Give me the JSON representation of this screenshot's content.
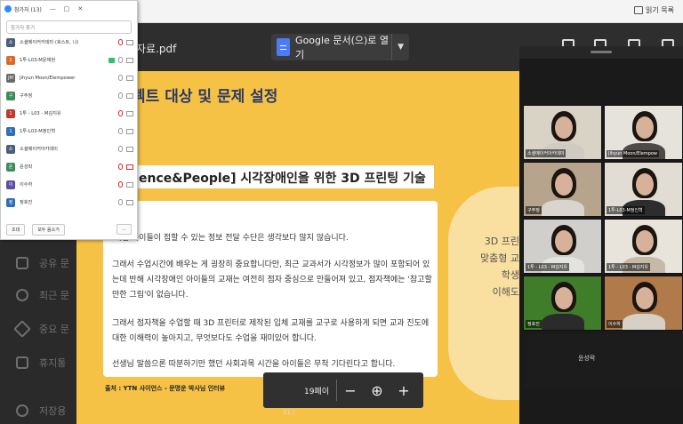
{
  "browser": {
    "reading_list": "읽기 목록"
  },
  "drive_sidebar": {
    "items": [
      {
        "label": "공유 문",
        "icon": "people-icon"
      },
      {
        "label": "최근 문",
        "icon": "clock-icon"
      },
      {
        "label": "중요 문",
        "icon": "star-icon"
      },
      {
        "label": "휴지통",
        "icon": "trash-icon"
      },
      {
        "label": "저장용",
        "icon": "cloud-icon"
      }
    ]
  },
  "pdf_viewer": {
    "filename": "자료.pdf",
    "open_with_label": "Google 문서(으)로 열기",
    "page_label": "19페이",
    "bottom_page_hint": "11   /",
    "toolbar_icons": [
      "folder-icon",
      "add-icon",
      "print-icon",
      "download-icon",
      "more-icon"
    ]
  },
  "slide": {
    "heading": "젝트 대상 및 문제 설정",
    "subtitle": "ence&People] 시각장애인을 위한 3D 프린팅 기술",
    "paragraphs": [
      "'애인 아이들이 접할 수 있는 정보 전달 수단은 생각보다 많지 않습니다.",
      "그래서 수업시간에 배우는 게 굉장히 중요합니다만, 최근 교과서가 시각정보가 많이 포함되어 있는데 반해 시각장애인 아이들의 교재는 여전히 점자 중심으로 만들어져 있고, 점자책에는 '참고할 만한 그림'이 없습니다.",
      "그래서 점자책을 수업할 때 3D 프린터로 제작된 입체 교재를 교구로 사용하게 되면 교과 진도에 대한 이해력이 높아지고, 무엇보다도 수업을 재미있어 합니다.",
      "선생님 말씀으론 따분하기만 했던 사회과목 시간을 아이들은 무척 기다린다고 합니다."
    ],
    "source": "출처 : YTN 사이언스 - 문명운 박사님 인터뷰",
    "side_text": [
      "3D 프린",
      "맞춤형 교",
      "학생",
      "이해도"
    ],
    "colors": {
      "background": "#f6c246",
      "heading": "#2b3a67",
      "underline": "#d22222"
    }
  },
  "participants_panel": {
    "title": "참가자 (13)",
    "search_placeholder": "참가자 찾기",
    "participants": [
      {
        "name": "소셜메이커카데미 (호스트, 나)",
        "avatar_text": "소",
        "avatar_color": "#4c5d7a",
        "mic_muted": true,
        "cam_off": false,
        "sharing": false
      },
      {
        "name": "1투-L03-M문채현",
        "avatar_text": "1",
        "avatar_color": "#d96b2b",
        "mic_muted": false,
        "cam_off": false,
        "sharing": true
      },
      {
        "name": "Jihyun Moon/Elempower",
        "avatar_text": "JM",
        "avatar_color": "#6a6a6a",
        "mic_muted": false,
        "cam_off": false,
        "sharing": false
      },
      {
        "name": "구주정",
        "avatar_text": "구",
        "avatar_color": "#3b8c5a",
        "mic_muted": false,
        "cam_off": false,
        "sharing": false
      },
      {
        "name": "1투 - L03 - M김지유",
        "avatar_text": "1",
        "avatar_color": "#c0392b",
        "mic_muted": true,
        "cam_off": false,
        "sharing": false
      },
      {
        "name": "1투-L03-M정인혁",
        "avatar_text": "1",
        "avatar_color": "#2e6fb7",
        "mic_muted": false,
        "cam_off": false,
        "sharing": false
      },
      {
        "name": "소셜메이커아카데미",
        "avatar_text": "소",
        "avatar_color": "#4c5d7a",
        "mic_muted": false,
        "cam_off": false,
        "sharing": false
      },
      {
        "name": "윤성락",
        "avatar_text": "윤",
        "avatar_color": "#3b8c5a",
        "mic_muted": true,
        "cam_off": true,
        "sharing": false
      },
      {
        "name": "이수하",
        "avatar_text": "이",
        "avatar_color": "#5a4fa3",
        "mic_muted": true,
        "cam_off": false,
        "sharing": false
      },
      {
        "name": "정호진",
        "avatar_text": "정",
        "avatar_color": "#2e6fb7",
        "mic_muted": false,
        "cam_off": false,
        "sharing": false
      }
    ],
    "footer": {
      "invite": "초대",
      "mute_all": "모두 음소거",
      "more": "..."
    }
  },
  "gallery": {
    "tiles": [
      {
        "name": "소셜메이커아카데미",
        "bg": "#d9d3c6",
        "shirt": "#cfcac2"
      },
      {
        "name": "Jihyun Moon/Elempow",
        "bg": "#e6e3dd",
        "shirt": "#4e4a47"
      },
      {
        "name": "구주정",
        "bg": "#b7a48d",
        "shirt": "#d8d5cf"
      },
      {
        "name": "1투-L03-M정인혁",
        "bg": "#e2ddd4",
        "shirt": "#2d2d2d"
      },
      {
        "name": "1투 - L03 - M김지유",
        "bg": "#d1cfcb",
        "shirt": "#e3e3e0"
      },
      {
        "name": "1투 - L03 - M김지유",
        "bg": "#e8e4dc",
        "shirt": "#c6b9a6"
      },
      {
        "name": "정호진",
        "bg": "#3f7d2a",
        "shirt": "#2b2b2b"
      },
      {
        "name": "이수하",
        "bg": "#b07a4a",
        "shirt": "#d6d0c6"
      }
    ],
    "blank_tile_name": "윤성락"
  }
}
